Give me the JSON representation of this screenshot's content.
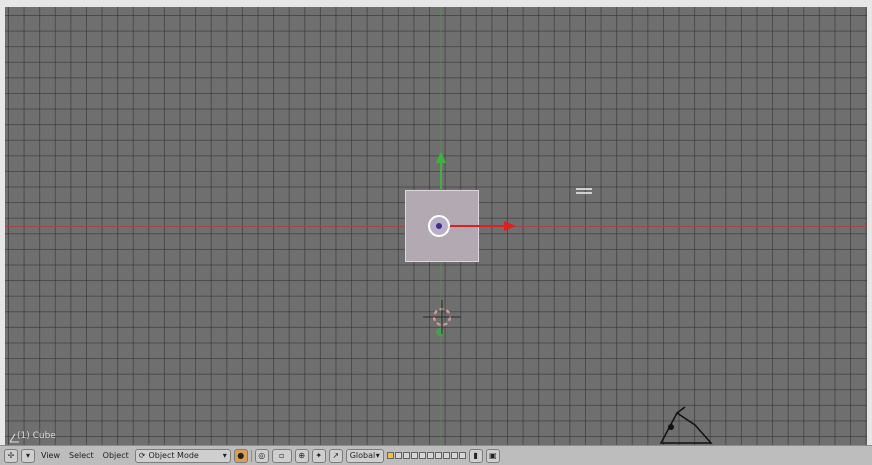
{
  "viewport": {
    "view_label": "(1) Cube",
    "colors": {
      "background": "#6f6f6f",
      "x_axis": "#e02020",
      "y_axis": "#40b040",
      "z_axis": "#3070d0",
      "selection": "#ffffff"
    }
  },
  "header": {
    "menus": [
      "View",
      "Select",
      "Object"
    ],
    "mode_label": "Object Mode",
    "pivot_label": "Global",
    "icons": [
      "editor-type-icon",
      "menu-collapse-icon",
      "mode-icon",
      "viewport-shading-icon",
      "pivot-icon",
      "snap-icon",
      "manipulator-icon",
      "layer-icon",
      "lock-icon",
      "render-icon"
    ]
  }
}
